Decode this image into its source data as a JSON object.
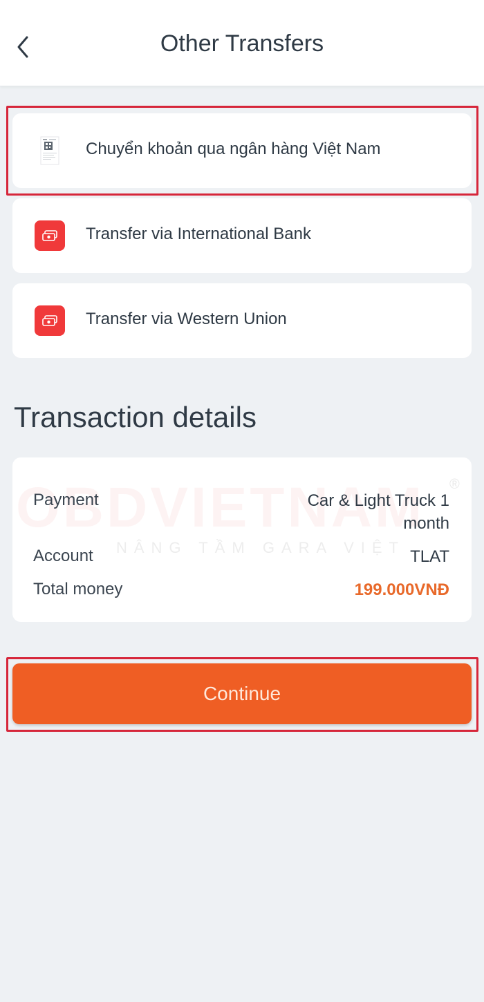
{
  "header": {
    "title": "Other Transfers",
    "back_icon": "chevron-left-icon"
  },
  "options": [
    {
      "label": "Chuyển khoản qua ngân hàng Việt Nam",
      "icon": "qr-document-icon",
      "highlighted": true
    },
    {
      "label": "Transfer via International Bank",
      "icon": "money-icon"
    },
    {
      "label": "Transfer via Western Union",
      "icon": "money-icon"
    }
  ],
  "transaction": {
    "title": "Transaction details",
    "rows": [
      {
        "label": "Payment",
        "value": "Car & Light Truck 1 month"
      },
      {
        "label": "Account",
        "value": "TLAT"
      },
      {
        "label": "Total money",
        "value": "199.000VNĐ"
      }
    ]
  },
  "watermark": {
    "brand": "OBDVIETNAM",
    "tagline": "NÂNG TẦM GARA VIỆT",
    "registered": "®"
  },
  "continue_button": {
    "label": "Continue"
  },
  "colors": {
    "accent": "#ef5e24",
    "money": "#e8692a",
    "highlight": "#d6263a",
    "icon_red": "#f0393a"
  }
}
